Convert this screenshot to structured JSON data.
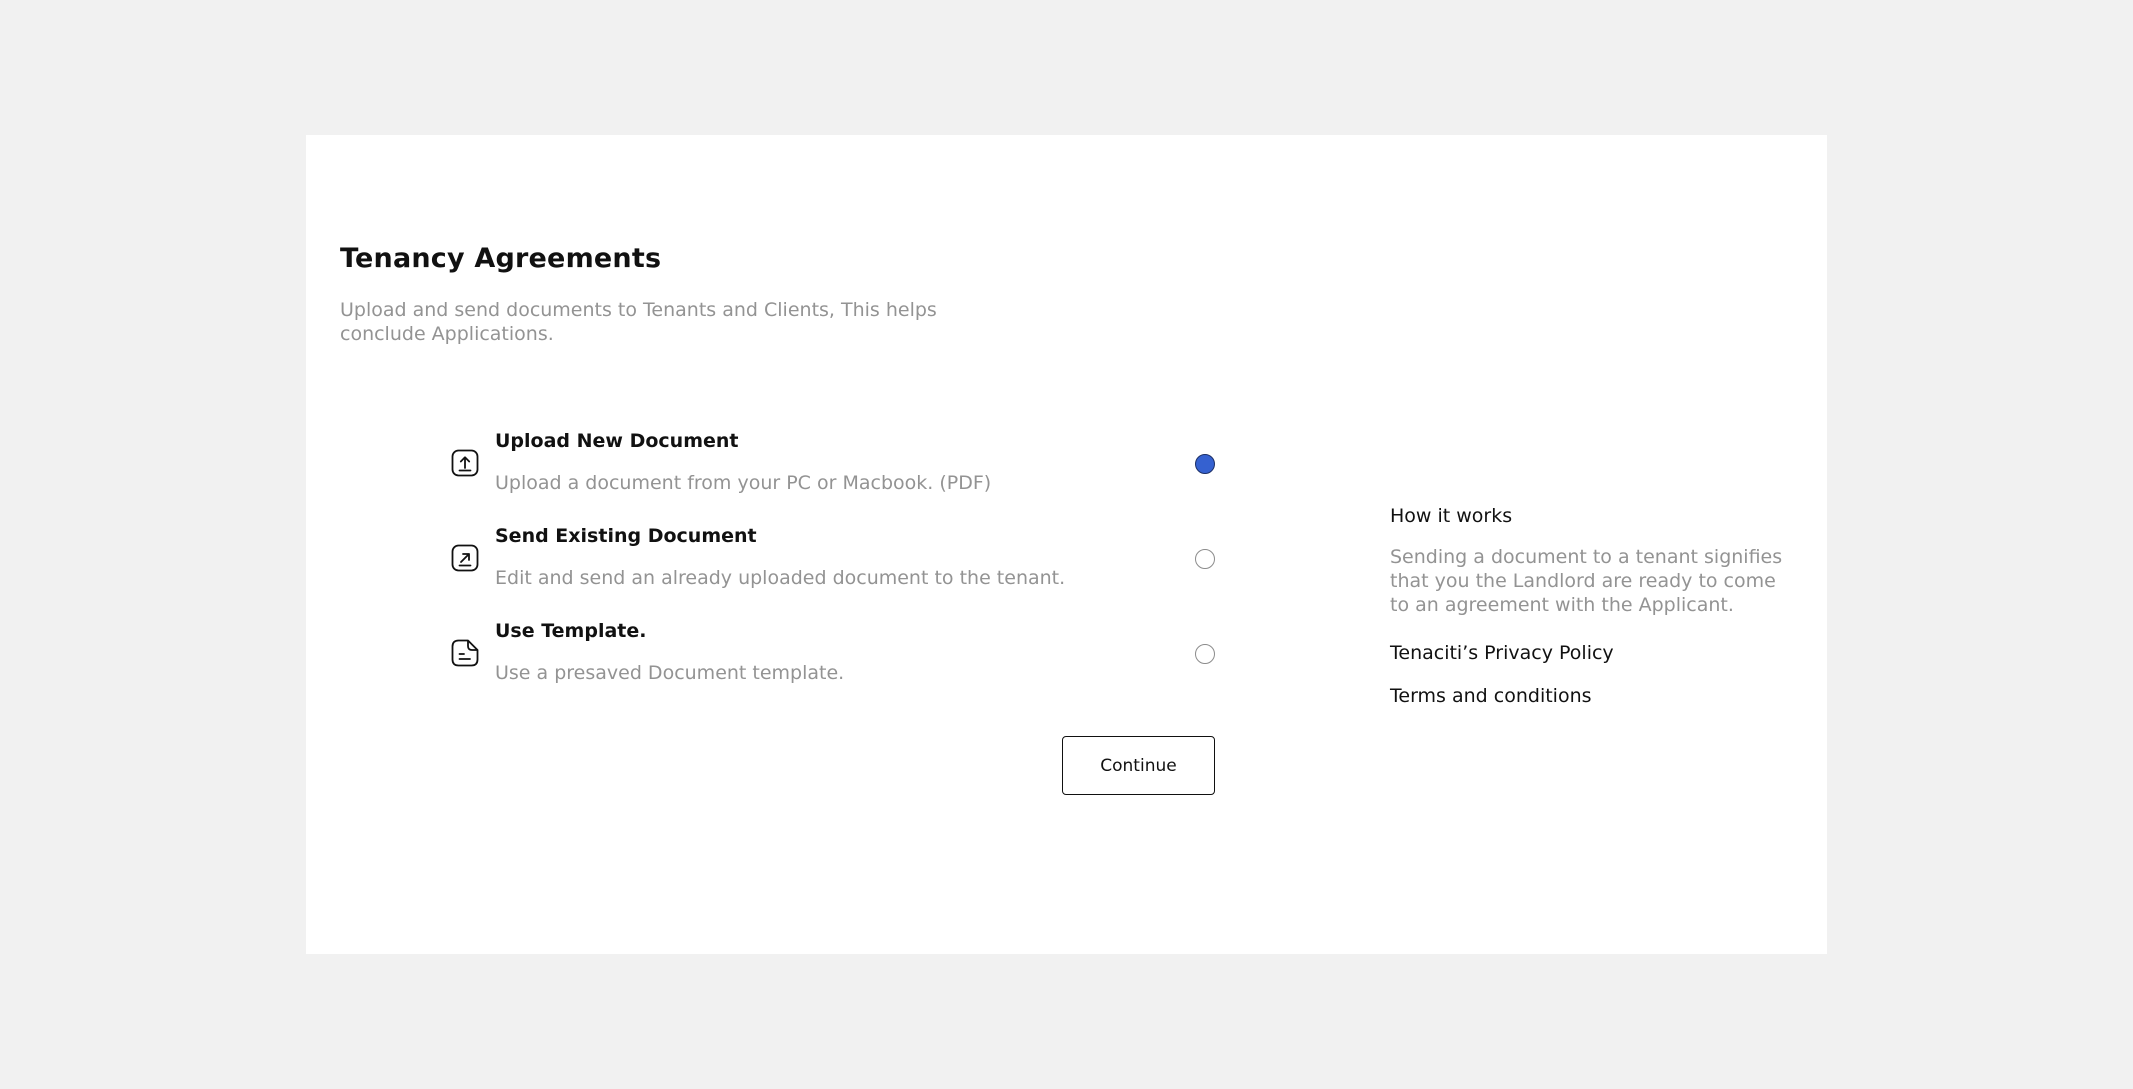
{
  "header": {
    "title": "Tenancy Agreements",
    "subtitle": "Upload and send documents to Tenants and Clients, This helps conclude Applications."
  },
  "options": [
    {
      "title": "Upload New Document",
      "description": "Upload a document from your PC or Macbook. (PDF)",
      "icon": "upload-icon",
      "selected": true
    },
    {
      "title": "Send Existing Document",
      "description": "Edit and send an already uploaded document to the tenant.",
      "icon": "send-arrow-icon",
      "selected": false
    },
    {
      "title": "Use Template.",
      "description": "Use a presaved Document template.",
      "icon": "document-template-icon",
      "selected": false
    }
  ],
  "actions": {
    "continue_label": "Continue"
  },
  "sidebar": {
    "how_title": "How it works",
    "how_text": "Sending a document to a tenant signifies that you the Landlord are ready to come to an agreement with the Applicant.",
    "privacy_link": "Tenaciti’s Privacy Policy",
    "terms_link": "Terms and conditions"
  },
  "colors": {
    "background": "#f1f1f1",
    "card": "#ffffff",
    "accent": "#3561d0",
    "muted_text": "#939393",
    "text": "#111111"
  }
}
